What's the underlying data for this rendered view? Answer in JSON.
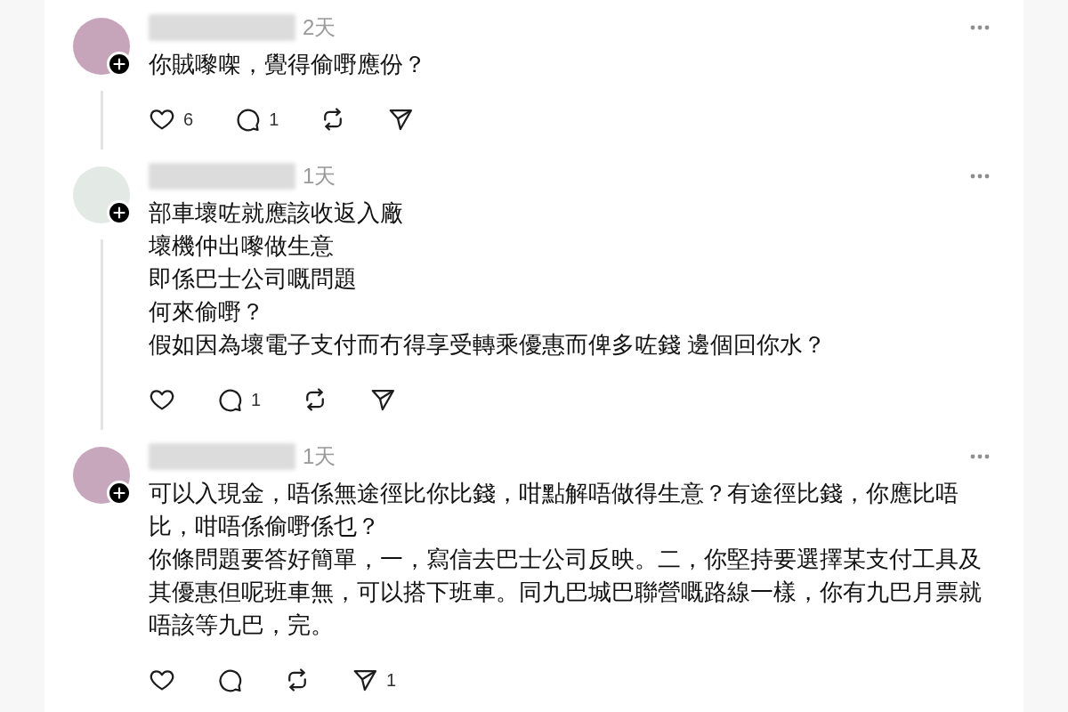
{
  "comments": [
    {
      "avatar": {
        "color": "#c6a5bb"
      },
      "time": "2天",
      "paragraphs": [
        "你賊嚟㗎，覺得偷嘢應份？"
      ],
      "actions": [
        {
          "kind": "like",
          "count": "6"
        },
        {
          "kind": "reply",
          "count": "1"
        },
        {
          "kind": "repost"
        },
        {
          "kind": "share"
        }
      ]
    },
    {
      "avatar": {
        "color": "#e3e9e4"
      },
      "time": "1天",
      "paragraphs": [
        "部車壞咗就應該收返入廠",
        "壞機仲出嚟做生意",
        "即係巴士公司嘅問題",
        "何來偷嘢？",
        "假如因為壞電子支付而冇得享受轉乘優惠而俾多咗錢 邊個回你水？"
      ],
      "actions": [
        {
          "kind": "like"
        },
        {
          "kind": "reply",
          "count": "1"
        },
        {
          "kind": "repost"
        },
        {
          "kind": "share"
        }
      ]
    },
    {
      "avatar": {
        "color": "#c7a7bc"
      },
      "time": "1天",
      "paragraphs": [
        "可以入現金，唔係無途徑比你比錢，咁點解唔做得生意？有途徑比錢，你應比唔比，咁唔係偷嘢係乜？",
        "你條問題要答好簡單，一，寫信去巴士公司反映。二，你堅持要選擇某支付工具及其優惠但呢班車無，可以搭下班車。同九巴城巴聯營嘅路線一樣，你有九巴月票就唔該等九巴，完。"
      ],
      "actions": [
        {
          "kind": "like"
        },
        {
          "kind": "reply"
        },
        {
          "kind": "repost"
        },
        {
          "kind": "share",
          "count": "1"
        }
      ]
    }
  ]
}
